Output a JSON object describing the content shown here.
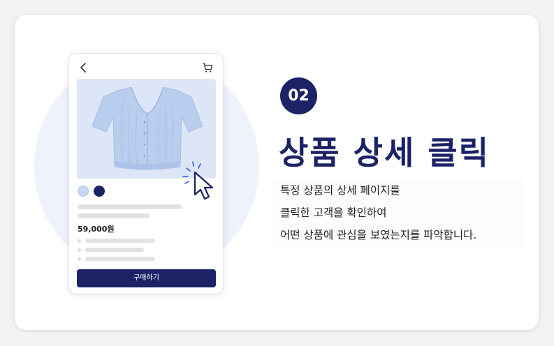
{
  "phone": {
    "price": "59,000원",
    "buy_button": "구매하기",
    "swatch_colors": [
      "#c9d6ef",
      "#1b2266"
    ]
  },
  "step": {
    "number": "02",
    "title": "상품 상세 클릭",
    "description": [
      "특정 상품의 상세 페이지를",
      "클릭한 고객을 확인하여",
      "어떤 상품에 관심을 보였는지를 파악합니다."
    ]
  },
  "colors": {
    "accent": "#1b2266",
    "background_circle": "#eef2fb",
    "product_background": "#dde6f6"
  }
}
